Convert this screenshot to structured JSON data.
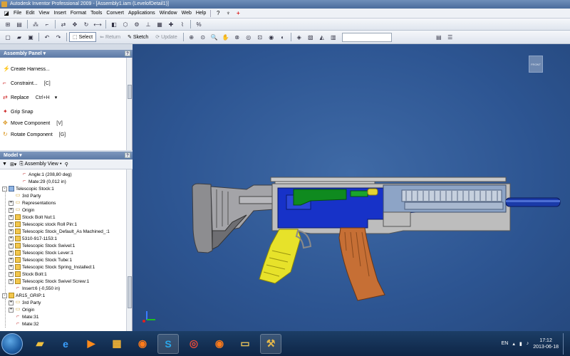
{
  "window": {
    "title": "Autodesk Inventor Professional 2009 - [Assembly1.iam (LevelofDetail1)]"
  },
  "menu": {
    "items": [
      "File",
      "Edit",
      "View",
      "Insert",
      "Format",
      "Tools",
      "Convert",
      "Applications",
      "Window",
      "Web",
      "Help"
    ]
  },
  "toolbar": {
    "select_label": "Select",
    "return_label": "Return",
    "sketch_label": "Sketch",
    "update_label": "Update"
  },
  "assembly_panel": {
    "title": "Assembly Panel",
    "commands": [
      {
        "label": "Create Harness...",
        "shortcut": "",
        "icon": "harness-icon"
      },
      {
        "label": "Constraint...",
        "shortcut": "[C]",
        "icon": "constraint-icon"
      },
      {
        "label": "Replace",
        "shortcut": "Ctrl+H",
        "icon": "replace-icon"
      },
      {
        "label": "Grip Snap",
        "shortcut": "",
        "icon": "grip-snap-icon"
      },
      {
        "label": "Move Component",
        "shortcut": "[V]",
        "icon": "move-icon"
      },
      {
        "label": "Rotate Component",
        "shortcut": "[G]",
        "icon": "rotate-icon"
      }
    ]
  },
  "model_panel": {
    "title": "Model",
    "view_label": "Assembly View",
    "tree": [
      {
        "label": "Angle:1 (208,80 deg)",
        "icon": "mate",
        "indent": 2,
        "toggle": ""
      },
      {
        "label": "Mate:29 (0,012 in)",
        "icon": "mate",
        "indent": 2,
        "toggle": ""
      },
      {
        "label": "Telescopic Stock:1",
        "icon": "sub",
        "indent": 0,
        "toggle": "-"
      },
      {
        "label": "3rd Party",
        "icon": "folder",
        "indent": 1,
        "toggle": ""
      },
      {
        "label": "Representations",
        "icon": "folder",
        "indent": 1,
        "toggle": "+"
      },
      {
        "label": "Origin",
        "icon": "folder",
        "indent": 1,
        "toggle": "+"
      },
      {
        "label": "Stock Bolt Nut:1",
        "icon": "part",
        "indent": 1,
        "toggle": "+"
      },
      {
        "label": "Telescopic stock Roll Pin:1",
        "icon": "part",
        "indent": 1,
        "toggle": "+"
      },
      {
        "label": "Telescopic Stock_Default_As Machined_:1",
        "icon": "part",
        "indent": 1,
        "toggle": "+"
      },
      {
        "label": "5310-917-1153:1",
        "icon": "part",
        "indent": 1,
        "toggle": "+"
      },
      {
        "label": "Telescopic Stock Swivel:1",
        "icon": "part",
        "indent": 1,
        "toggle": "+"
      },
      {
        "label": "Telescopic Stock Lever:1",
        "icon": "part",
        "indent": 1,
        "toggle": "+"
      },
      {
        "label": "Telescopic Stock Tube:1",
        "icon": "part",
        "indent": 1,
        "toggle": "+"
      },
      {
        "label": "Telescopic Stock Spring_Installed:1",
        "icon": "part",
        "indent": 1,
        "toggle": "+"
      },
      {
        "label": "Stock Bolt:1",
        "icon": "part",
        "indent": 1,
        "toggle": "+"
      },
      {
        "label": "Telescopic Stock Swivel Screw:1",
        "icon": "part",
        "indent": 1,
        "toggle": "+"
      },
      {
        "label": "Insert:6 (-0,550 in)",
        "icon": "mate",
        "indent": 1,
        "toggle": ""
      },
      {
        "label": "AR15_GRIP:1",
        "icon": "part",
        "indent": 0,
        "toggle": "-"
      },
      {
        "label": "3rd Party",
        "icon": "folder",
        "indent": 1,
        "toggle": "+"
      },
      {
        "label": "Origin",
        "icon": "folder",
        "indent": 1,
        "toggle": "+"
      },
      {
        "label": "Mate:31",
        "icon": "mate",
        "indent": 1,
        "toggle": ""
      },
      {
        "label": "Mate:32",
        "icon": "mate",
        "indent": 1,
        "toggle": ""
      }
    ]
  },
  "viewport": {
    "viewcube_label": "FRONT"
  },
  "taskbar": {
    "language": "EN",
    "time": "17:12",
    "date": "2013-06-18",
    "apps": [
      "explorer-icon",
      "ie-icon",
      "media-icon",
      "app-icon",
      "firefox-icon",
      "skype-icon",
      "chrome-icon",
      "firefox-icon",
      "folder-icon",
      "inventor-icon"
    ]
  }
}
